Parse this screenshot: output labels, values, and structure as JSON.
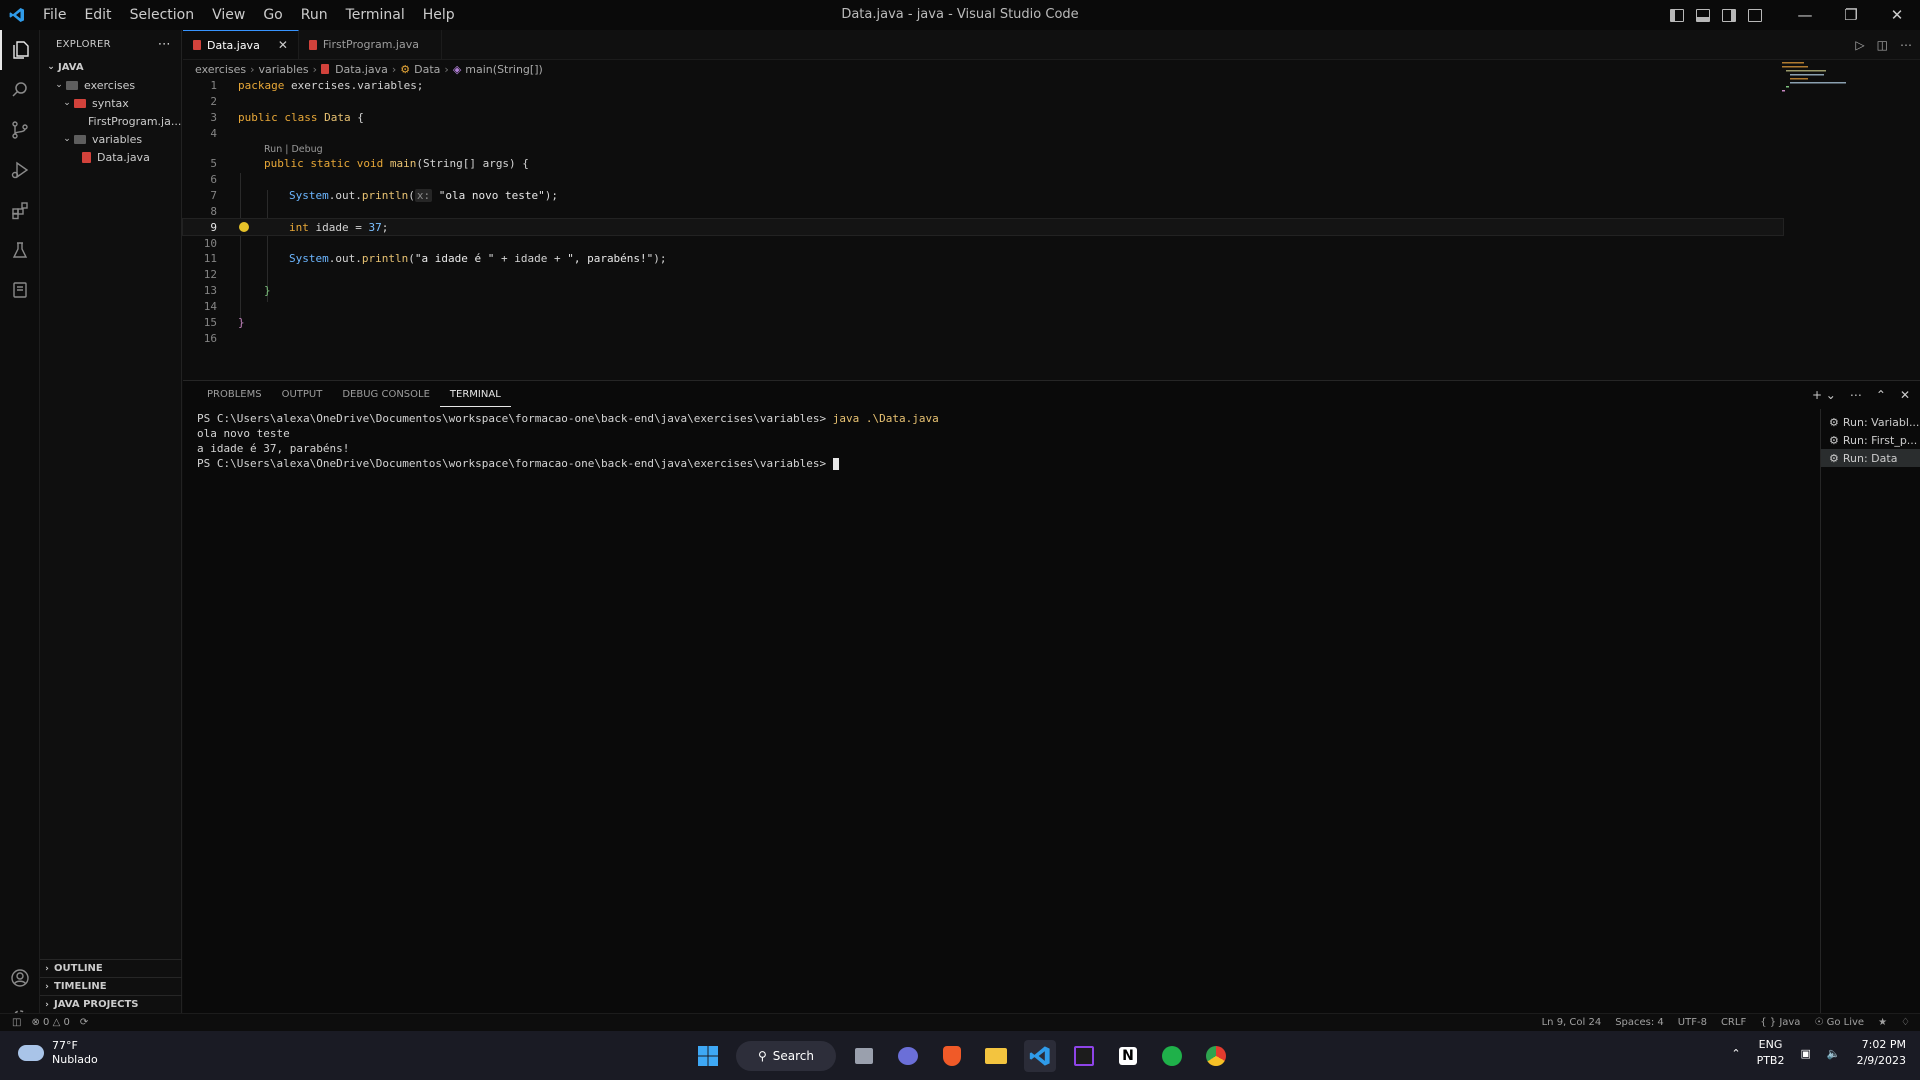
{
  "window": {
    "title": "Data.java - java - Visual Studio Code",
    "menu": [
      "File",
      "Edit",
      "Selection",
      "View",
      "Go",
      "Run",
      "Terminal",
      "Help"
    ]
  },
  "sidebar": {
    "header": "EXPLORER",
    "root": "JAVA",
    "tree": [
      {
        "label": "exercises",
        "depth": 1,
        "kind": "folder"
      },
      {
        "label": "syntax",
        "depth": 2,
        "kind": "folder-red"
      },
      {
        "label": "FirstProgram.ja...",
        "depth": 3,
        "kind": "java"
      },
      {
        "label": "variables",
        "depth": 2,
        "kind": "folder"
      },
      {
        "label": "Data.java",
        "depth": 3,
        "kind": "java"
      }
    ],
    "bottom_panes": [
      "OUTLINE",
      "TIMELINE",
      "JAVA PROJECTS"
    ]
  },
  "editor": {
    "tabs": [
      {
        "label": "Data.java",
        "active": true
      },
      {
        "label": "FirstProgram.java",
        "active": false
      }
    ],
    "breadcrumb": [
      "exercises",
      "variables",
      "Data.java",
      "Data",
      "main(String[])"
    ],
    "codelens": "Run | Debug",
    "current_line": 9,
    "lines": [
      "1",
      "2",
      "3",
      "4",
      "5",
      "6",
      "7",
      "8",
      "9",
      "10",
      "11",
      "12",
      "13",
      "14",
      "15",
      "16"
    ]
  },
  "code": {
    "l1_kw": "package",
    "l1_rest": " exercises.variables;",
    "l3_kw": "public class",
    "l3_cls": " Data",
    "l3_rest": " {",
    "l5_kw": "public static void",
    "l5_fn": " main",
    "l5_rest": "(String[] args) {",
    "l7_obj": "System",
    "l7_mid": ".out.",
    "l7_fn": "println",
    "l7_hint": "x:",
    "l7_str": "\"ola novo teste\"",
    "l7_end": ");",
    "l9_type": "int",
    "l9_mid": " idade = ",
    "l9_num": "37",
    "l9_end": ";",
    "l11_obj": "System",
    "l11_mid": ".out.",
    "l11_fn": "println",
    "l11_open": "(",
    "l11_str1": "\"a idade é \"",
    "l11_plus1": " + idade + ",
    "l11_str2": "\", parabéns!\"",
    "l11_end": ");",
    "l13": "}",
    "l15": "}"
  },
  "panel": {
    "tabs": [
      "PROBLEMS",
      "OUTPUT",
      "DEBUG CONSOLE",
      "TERMINAL"
    ],
    "active_tab": "TERMINAL",
    "terminal": {
      "prompt": "PS C:\\Users\\alexa\\OneDrive\\Documentos\\workspace\\formacao-one\\back-end\\java\\exercises\\variables> ",
      "command": "java .\\Data.java",
      "output1": "ola novo teste",
      "output2": "a idade é 37, parabéns!"
    },
    "terminal_list": [
      "Run: Variabl...",
      "Run: First_p...",
      "Run: Data"
    ]
  },
  "statusbar": {
    "errors": "0",
    "warnings": "0",
    "position": "Ln 9, Col 24",
    "spaces": "Spaces: 4",
    "encoding": "UTF-8",
    "eol": "CRLF",
    "language": "Java",
    "golive": "Go Live"
  },
  "taskbar": {
    "temp": "77°F",
    "weather": "Nublado",
    "search": "Search",
    "lang1": "ENG",
    "lang2": "PTB2",
    "time": "7:02 PM",
    "date": "2/9/2023"
  },
  "colors": {
    "accent": "#3794ff",
    "java_icon": "#d2423b",
    "keyword": "#e8a838"
  }
}
